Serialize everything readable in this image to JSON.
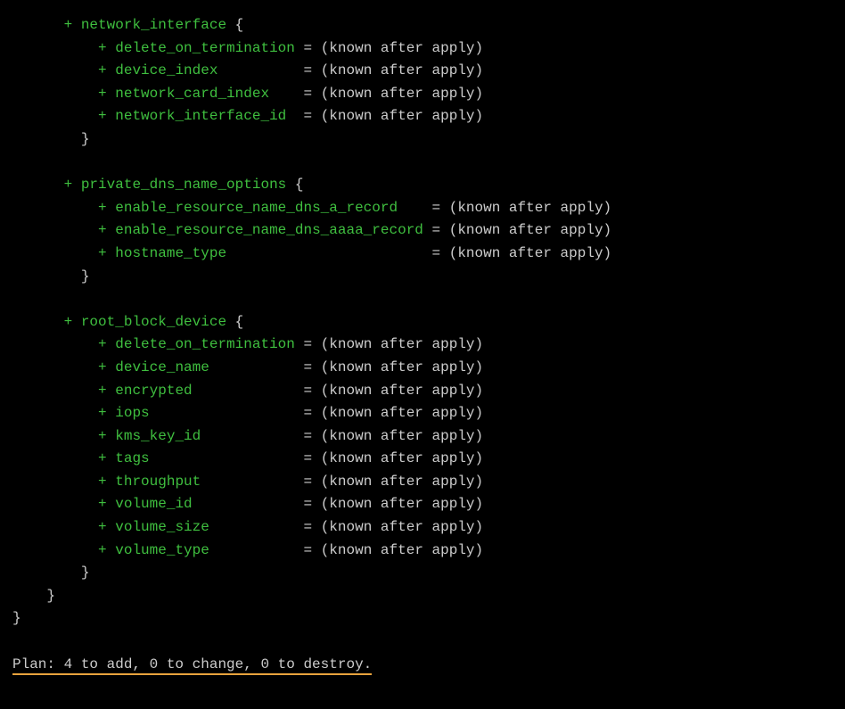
{
  "blocks": [
    {
      "name": "network_interface",
      "attrs": [
        {
          "key": "delete_on_termination",
          "value": "(known after apply)"
        },
        {
          "key": "device_index",
          "value": "(known after apply)"
        },
        {
          "key": "network_card_index",
          "value": "(known after apply)"
        },
        {
          "key": "network_interface_id",
          "value": "(known after apply)"
        }
      ]
    },
    {
      "name": "private_dns_name_options",
      "attrs": [
        {
          "key": "enable_resource_name_dns_a_record",
          "value": "(known after apply)"
        },
        {
          "key": "enable_resource_name_dns_aaaa_record",
          "value": "(known after apply)"
        },
        {
          "key": "hostname_type",
          "value": "(known after apply)"
        }
      ]
    },
    {
      "name": "root_block_device",
      "attrs": [
        {
          "key": "delete_on_termination",
          "value": "(known after apply)"
        },
        {
          "key": "device_name",
          "value": "(known after apply)"
        },
        {
          "key": "encrypted",
          "value": "(known after apply)"
        },
        {
          "key": "iops",
          "value": "(known after apply)"
        },
        {
          "key": "kms_key_id",
          "value": "(known after apply)"
        },
        {
          "key": "tags",
          "value": "(known after apply)"
        },
        {
          "key": "throughput",
          "value": "(known after apply)"
        },
        {
          "key": "volume_id",
          "value": "(known after apply)"
        },
        {
          "key": "volume_size",
          "value": "(known after apply)"
        },
        {
          "key": "volume_type",
          "value": "(known after apply)"
        }
      ]
    }
  ],
  "plan": {
    "prefix": "Plan:",
    "add": 4,
    "change": 0,
    "destroy": 0,
    "text": "Plan: 4 to add, 0 to change, 0 to destroy."
  }
}
